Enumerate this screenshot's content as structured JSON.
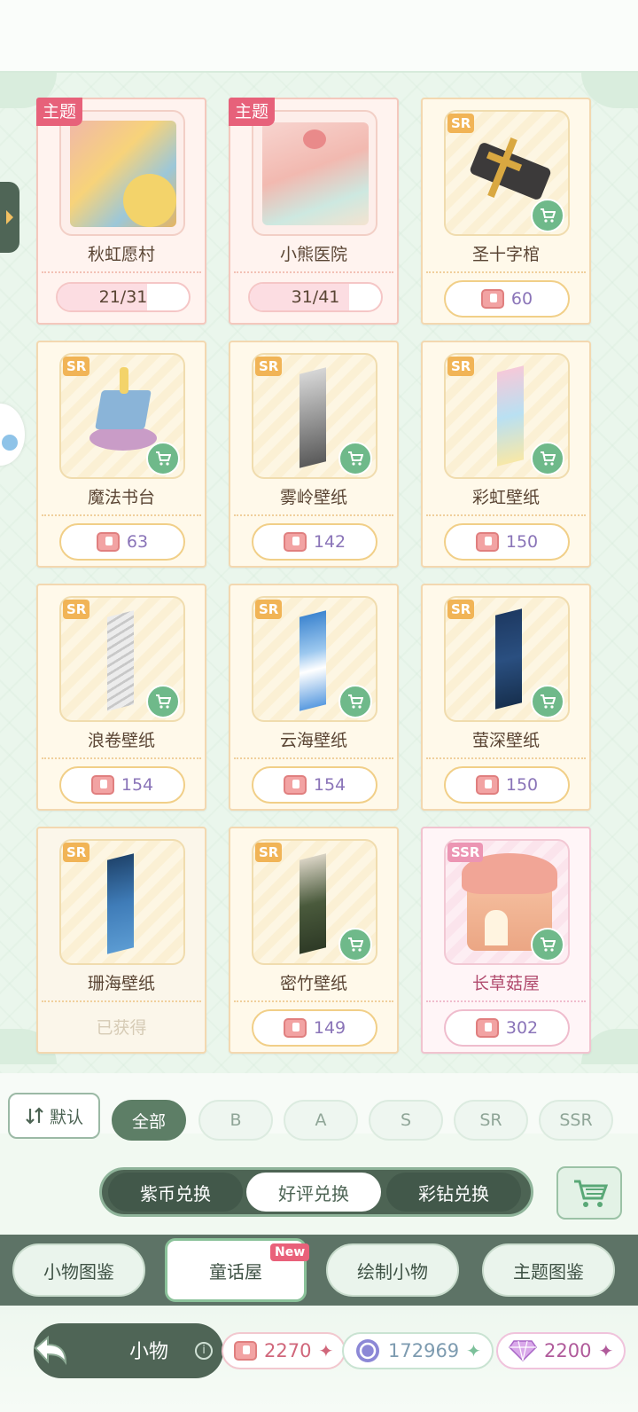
{
  "items": [
    {
      "name": "秋虹愿村",
      "tag": "主题",
      "kind": "theme",
      "progress": "21/31",
      "progress_fraction": 0.68
    },
    {
      "name": "小熊医院",
      "tag": "主题",
      "kind": "theme",
      "progress": "31/41",
      "progress_fraction": 0.76
    },
    {
      "name": "圣十字棺",
      "rarity": "SR",
      "price": "60"
    },
    {
      "name": "魔法书台",
      "rarity": "SR",
      "price": "63"
    },
    {
      "name": "雾岭壁纸",
      "rarity": "SR",
      "price": "142"
    },
    {
      "name": "彩虹壁纸",
      "rarity": "SR",
      "price": "150"
    },
    {
      "name": "浪卷壁纸",
      "rarity": "SR",
      "price": "154"
    },
    {
      "name": "云海壁纸",
      "rarity": "SR",
      "price": "154"
    },
    {
      "name": "萤深壁纸",
      "rarity": "SR",
      "price": "150"
    },
    {
      "name": "珊海壁纸",
      "rarity": "SR",
      "status": "已获得"
    },
    {
      "name": "密竹壁纸",
      "rarity": "SR",
      "price": "149"
    },
    {
      "name": "长草菇屋",
      "rarity": "SSR",
      "price": "302"
    }
  ],
  "sort": {
    "label": "默认"
  },
  "filters": [
    "全部",
    "B",
    "A",
    "S",
    "SR",
    "SSR"
  ],
  "exchange_tabs": [
    "紫币兑换",
    "好评兑换",
    "彩钻兑换"
  ],
  "nav_tabs": [
    "小物图鉴",
    "童话屋",
    "绘制小物",
    "主题图鉴"
  ],
  "nav_badge": "New",
  "section_title": "小物",
  "info_symbol": "i",
  "currencies": [
    {
      "icon": "thumb-up-coupon-icon",
      "value": "2270",
      "color": "#d0667a"
    },
    {
      "icon": "purple-coin-icon",
      "value": "172969",
      "color": "#7d9bb0"
    },
    {
      "icon": "diamond-icon",
      "value": "2200",
      "color": "#b05a9a"
    }
  ],
  "colors": {
    "accent_green": "#5d7e66",
    "theme_tag": "#e7617a",
    "sr_tag": "#f1b456",
    "ssr_tag": "#ec95b3"
  }
}
